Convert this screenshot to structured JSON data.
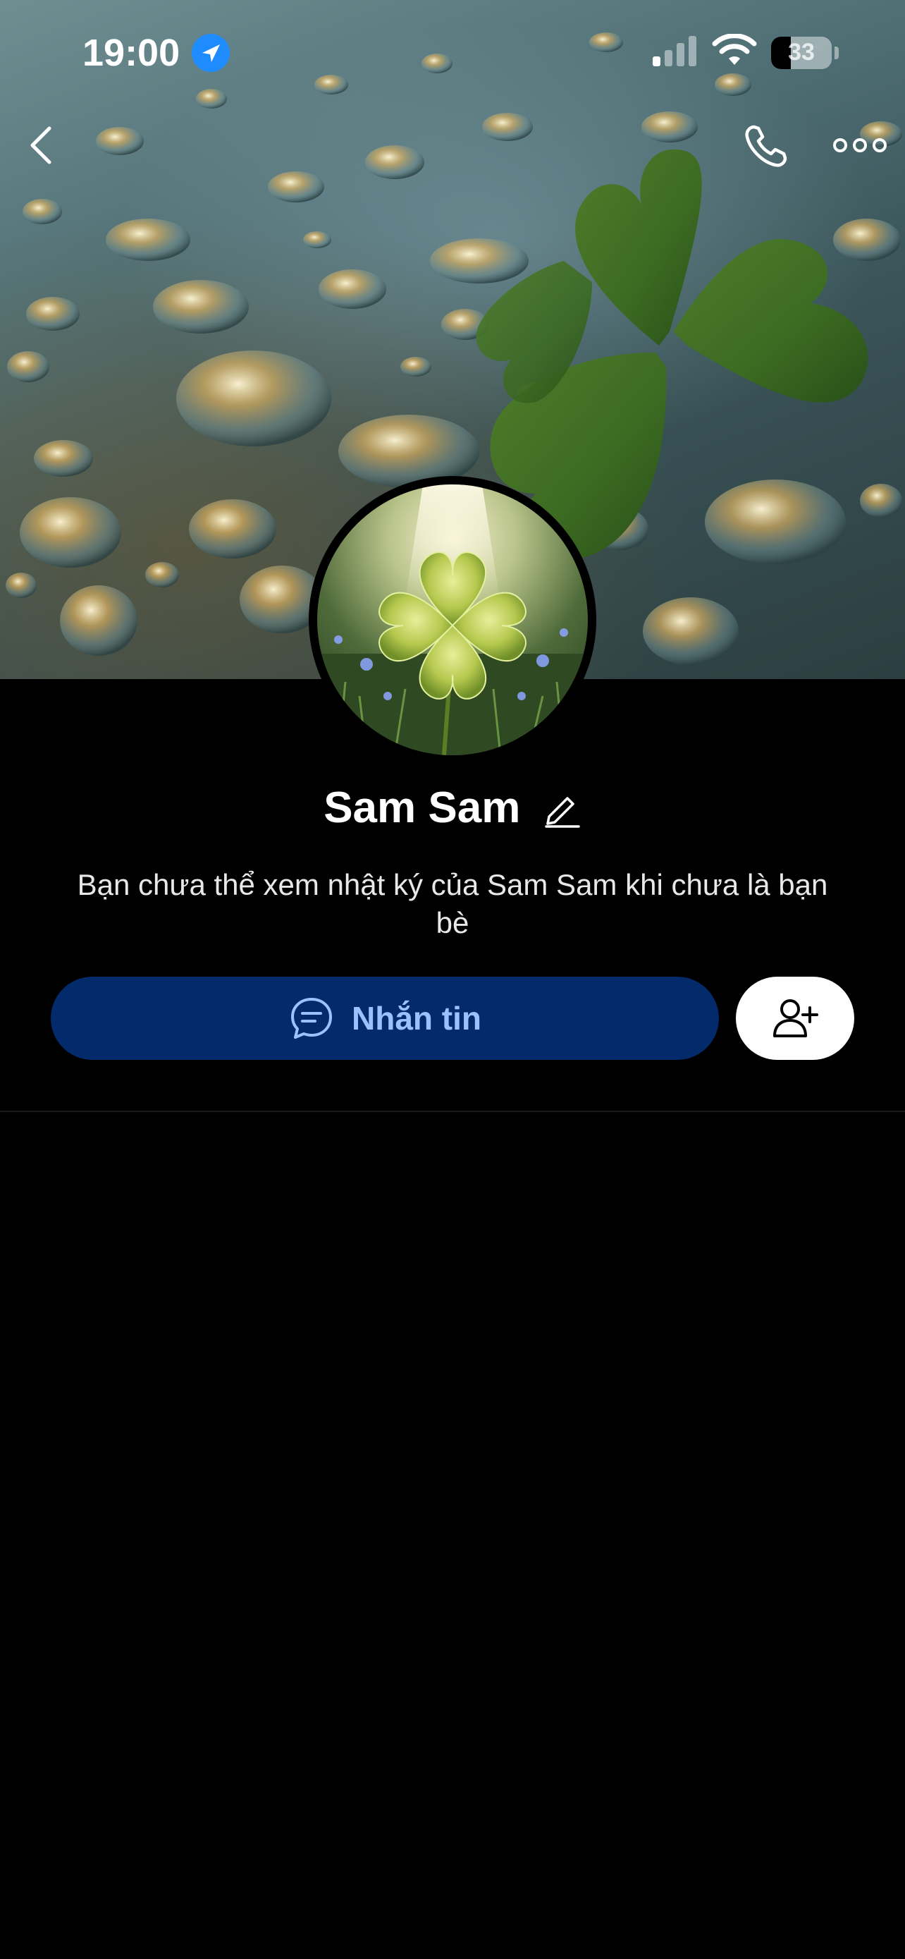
{
  "status_bar": {
    "time": "19:00",
    "battery_level": "33",
    "battery_fraction": 0.33,
    "icons": [
      "location-arrow-icon",
      "cellular-signal-icon",
      "wifi-icon",
      "battery-icon"
    ]
  },
  "nav": {
    "icons": [
      "back-chevron-icon",
      "phone-icon",
      "more-dots-icon"
    ]
  },
  "profile": {
    "name": "Sam Sam",
    "note": "Bạn chưa thể xem nhật ký của Sam Sam khi chưa là bạn bè"
  },
  "actions": {
    "message_label": "Nhắn tin",
    "message_icon": "chat-bubble-icon",
    "add_friend_icon": "add-friend-icon"
  },
  "colors": {
    "background": "#000000",
    "message_button": "#032a6b",
    "message_label": "#9cc1ff",
    "add_button": "#ffffff",
    "location_badge": "#1e8cff"
  }
}
